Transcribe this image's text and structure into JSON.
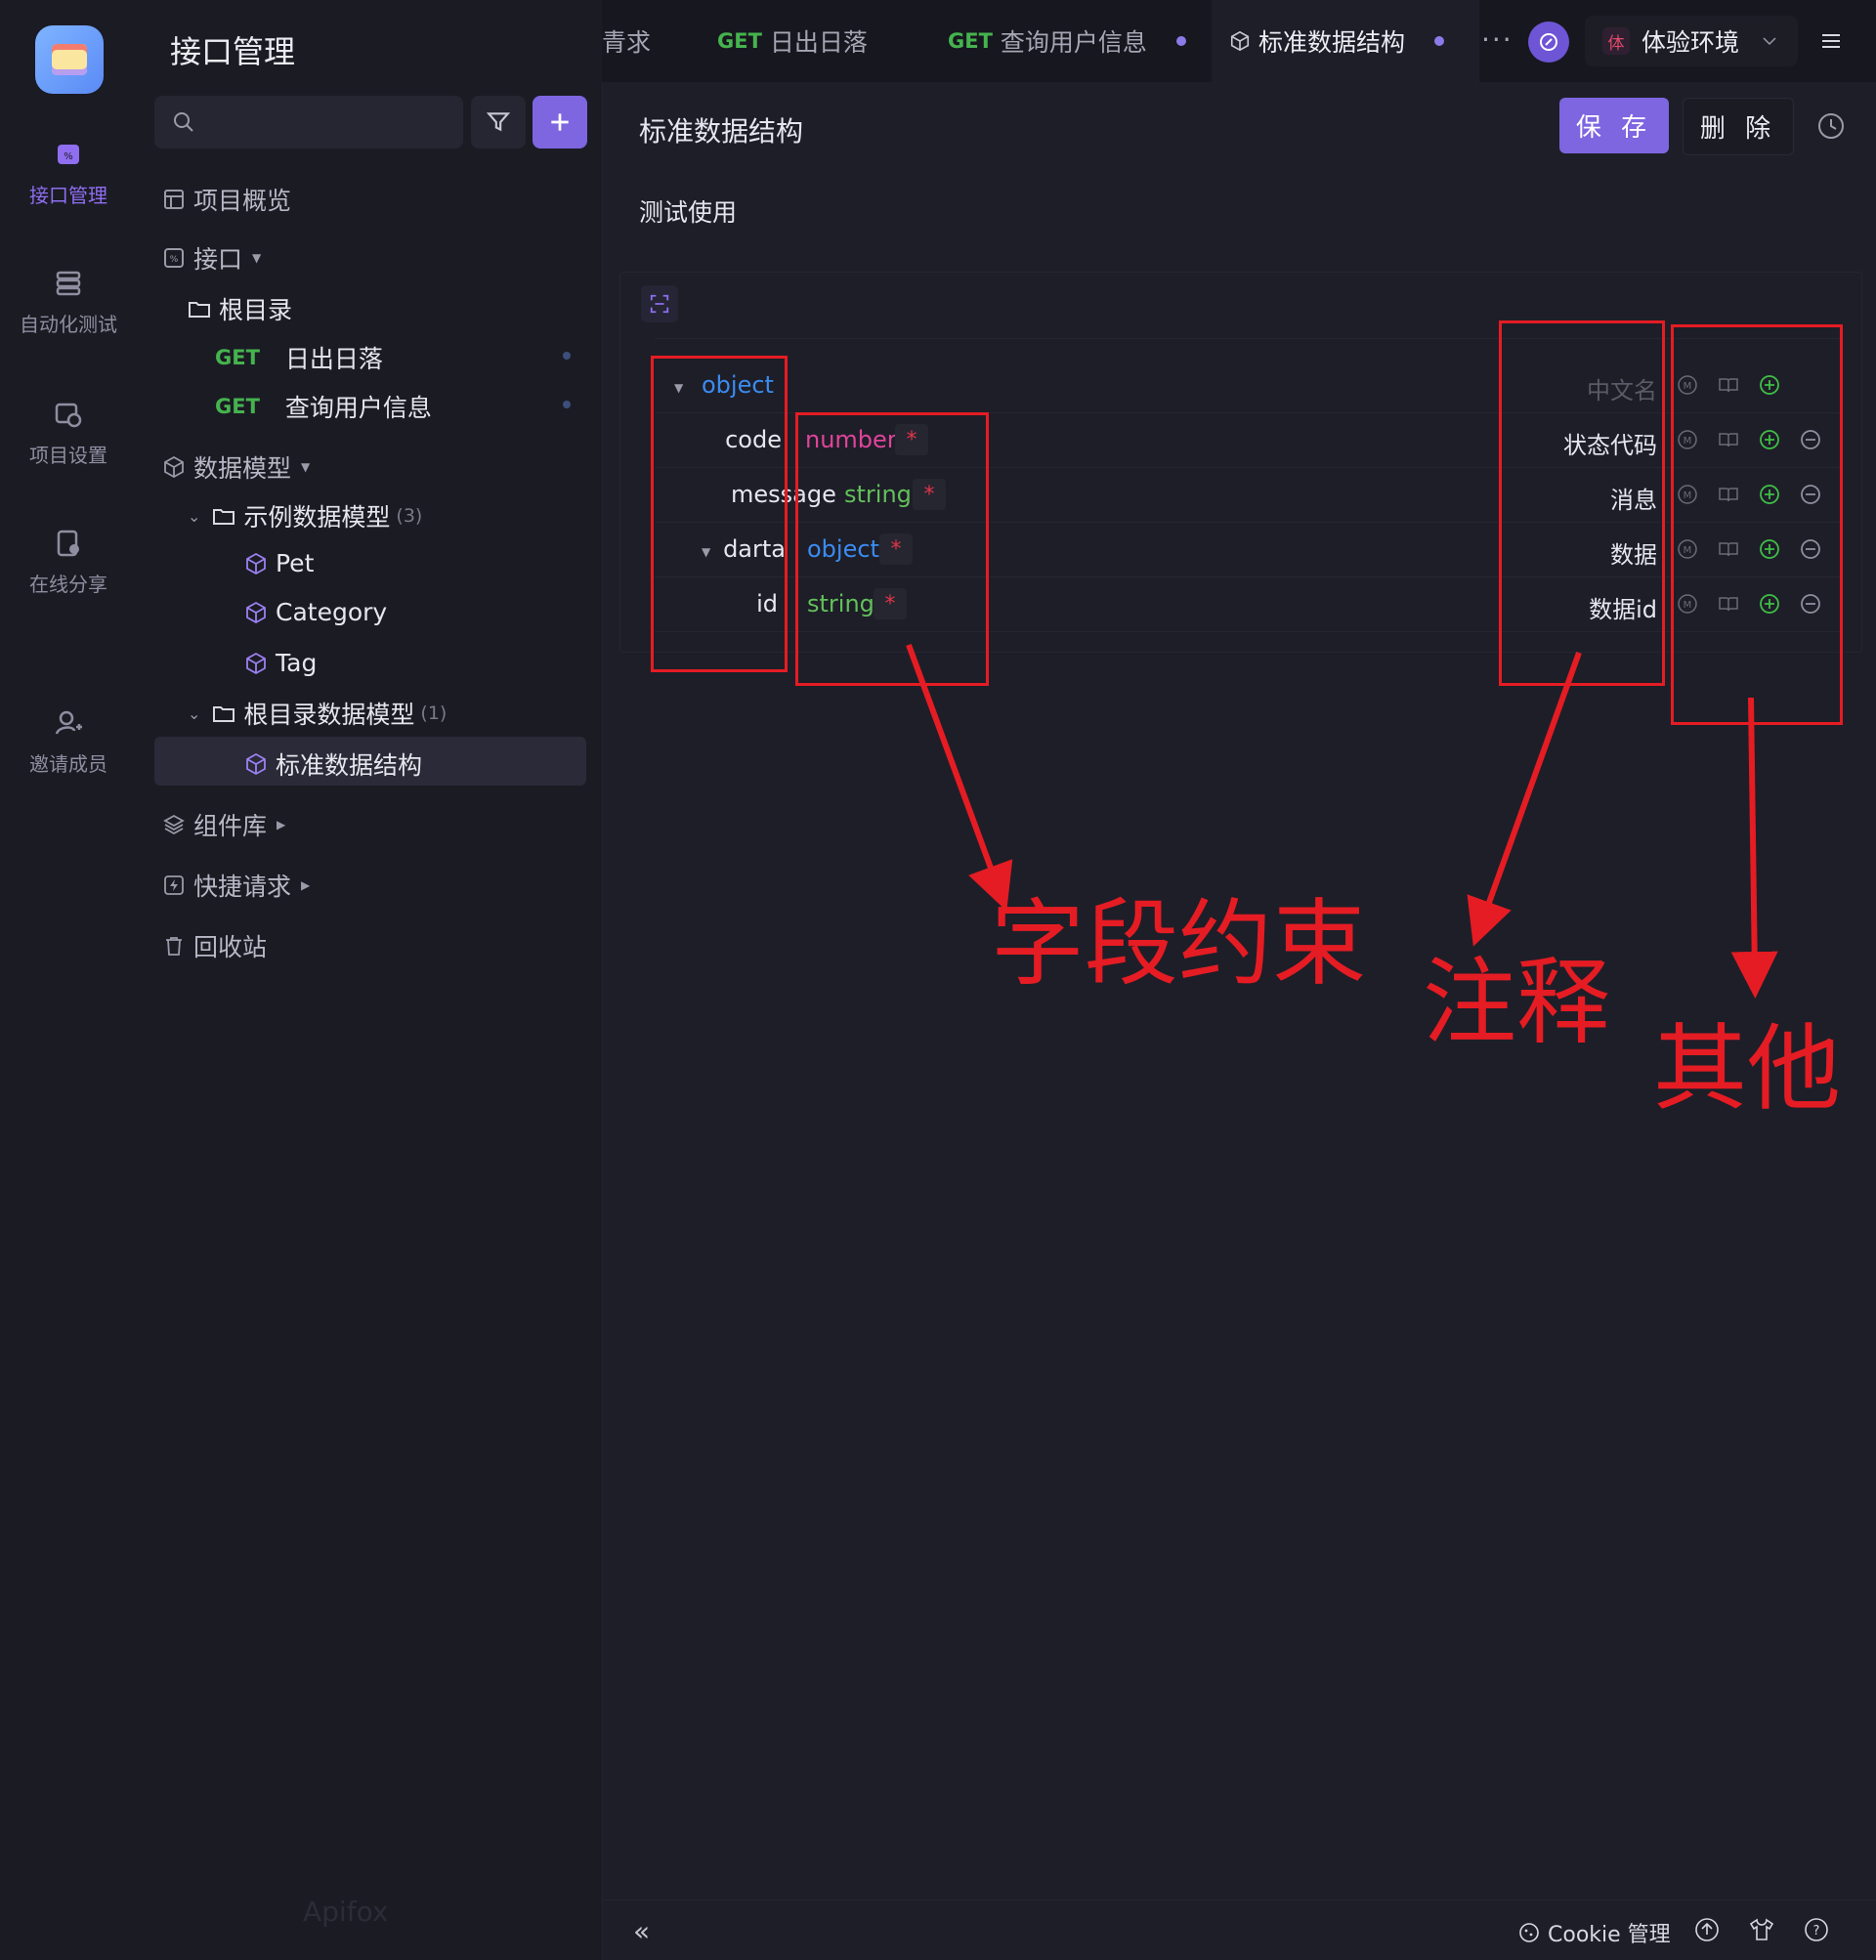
{
  "app": {
    "brand_watermark": "Apifox"
  },
  "rail": {
    "items": [
      {
        "label": "接口管理",
        "icon": "api-icon",
        "active": true
      },
      {
        "label": "自动化测试",
        "icon": "automation-icon"
      },
      {
        "label": "项目设置",
        "icon": "settings-icon"
      },
      {
        "label": "在线分享",
        "icon": "share-icon"
      },
      {
        "label": "邀请成员",
        "icon": "add-user-icon"
      }
    ]
  },
  "sidebar": {
    "title": "接口管理",
    "search_placeholder": "",
    "tree": {
      "overview": "项目概览",
      "apis": "接口",
      "root_dir": "根目录",
      "endpoints": [
        {
          "method": "GET",
          "name": "日出日落"
        },
        {
          "method": "GET",
          "name": "查询用户信息"
        }
      ],
      "data_models": "数据模型",
      "example_folder": "示例数据模型",
      "example_count": "(3)",
      "example_models": [
        "Pet",
        "Category",
        "Tag"
      ],
      "root_models_folder": "根目录数据模型",
      "root_models_count": "(1)",
      "root_models": [
        "标准数据结构"
      ],
      "components": "组件库",
      "quick_requests": "快捷请求",
      "recycle_bin": "回收站"
    }
  },
  "tabs": {
    "items": [
      {
        "partial": true,
        "label": "青求"
      },
      {
        "method": "GET",
        "label": "日出日落"
      },
      {
        "method": "GET",
        "label": "查询用户信息"
      },
      {
        "label": "标准数据结构",
        "active": true
      }
    ],
    "more": "···",
    "environment": {
      "badge": "体",
      "label": "体验环境"
    }
  },
  "main": {
    "title": "标准数据结构",
    "save_label": "保 存",
    "delete_label": "删 除",
    "description": "测试使用",
    "schema": {
      "root_type": "object",
      "root_comment_placeholder": "中文名",
      "fields": [
        {
          "name": "code",
          "type": "number",
          "required": "*",
          "comment": "状态代码"
        },
        {
          "name": "message",
          "type": "string",
          "required": "*",
          "comment": "消息"
        },
        {
          "name": "darta",
          "type": "object",
          "required": "*",
          "comment": "数据"
        },
        {
          "name": "id",
          "type": "string",
          "required": "*",
          "comment": "数据id"
        }
      ]
    }
  },
  "annotations": {
    "constraints": "字段约束",
    "comments": "注释",
    "others": "其他",
    "color": "#e51c23"
  },
  "footer": {
    "cookie_label": "Cookie 管理"
  },
  "colors": {
    "accent": "#7e66e0",
    "get_method": "#45b34e",
    "type_object": "#3a8cf0",
    "type_number": "#e0449b",
    "type_string": "#62c05a"
  }
}
